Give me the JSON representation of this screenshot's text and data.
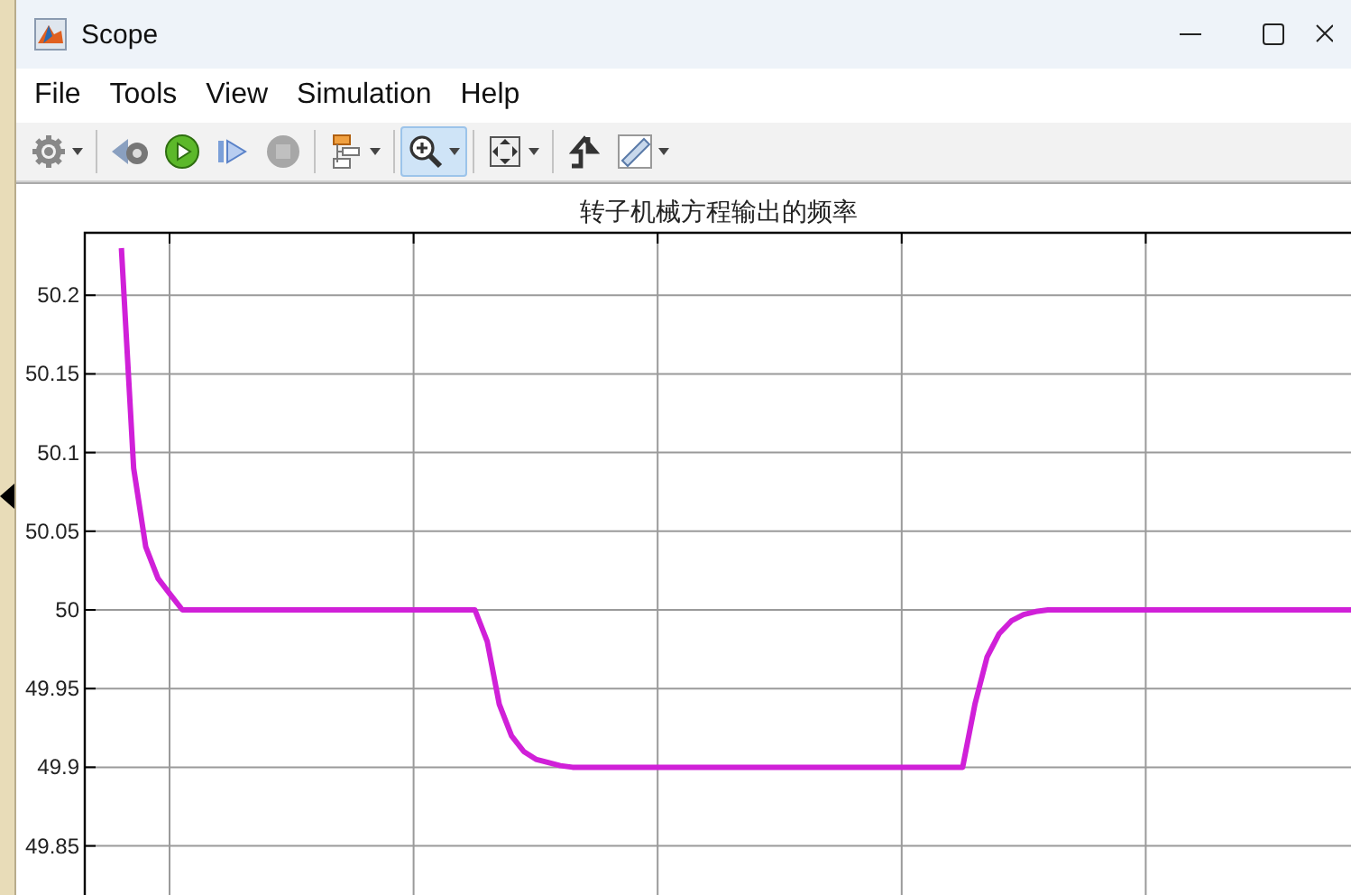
{
  "window": {
    "title": "Scope"
  },
  "menu": [
    "File",
    "Tools",
    "View",
    "Simulation",
    "Help"
  ],
  "toolbar": [
    {
      "kind": "gear",
      "dropdown": true,
      "selected": false,
      "disabled": false
    },
    {
      "kind": "separator"
    },
    {
      "kind": "rewind",
      "dropdown": false,
      "selected": false,
      "disabled": false
    },
    {
      "kind": "play",
      "dropdown": false,
      "selected": false,
      "disabled": false
    },
    {
      "kind": "step",
      "dropdown": false,
      "selected": false,
      "disabled": false
    },
    {
      "kind": "stop",
      "dropdown": false,
      "selected": false,
      "disabled": true
    },
    {
      "kind": "separator"
    },
    {
      "kind": "layout",
      "dropdown": true,
      "selected": false,
      "disabled": false
    },
    {
      "kind": "separator"
    },
    {
      "kind": "zoom",
      "dropdown": true,
      "selected": true,
      "disabled": false
    },
    {
      "kind": "separator"
    },
    {
      "kind": "fit",
      "dropdown": true,
      "selected": false,
      "disabled": false
    },
    {
      "kind": "separator"
    },
    {
      "kind": "trigger",
      "dropdown": false,
      "selected": false,
      "disabled": false
    },
    {
      "kind": "ruler",
      "dropdown": true,
      "selected": false,
      "disabled": false
    }
  ],
  "plot": {
    "chart_data": {
      "type": "line",
      "title": "转子机械方程输出的频率",
      "categories": [
        null,
        null,
        null,
        null,
        null,
        null,
        null,
        null,
        null,
        null,
        null,
        null,
        null,
        null,
        null,
        null,
        null,
        null,
        null,
        null,
        null,
        null,
        null,
        null,
        null,
        null,
        null,
        null,
        null,
        null,
        null,
        null,
        null,
        null,
        null,
        null,
        null,
        null,
        null,
        null,
        null,
        null,
        null,
        null,
        null,
        null,
        null,
        null,
        null,
        null,
        null,
        null,
        null,
        null,
        null,
        null,
        null,
        null,
        null,
        null,
        null,
        null,
        null,
        null,
        null,
        null,
        null,
        null,
        null,
        null,
        null,
        null,
        null,
        null,
        null,
        null,
        null,
        null,
        null,
        null,
        null,
        null,
        null,
        null,
        null,
        null,
        null,
        null,
        null,
        null,
        null,
        null,
        null,
        null,
        null,
        null,
        null,
        null,
        null,
        null,
        null,
        null
      ],
      "series": [
        {
          "color": "#d020d8",
          "values": [
            50.23,
            50.09,
            50.04,
            50.02,
            50.01,
            50,
            50,
            50,
            50,
            50,
            50,
            50,
            50,
            50,
            50,
            50,
            50,
            50,
            50,
            50,
            50,
            50,
            50,
            50,
            50,
            50,
            50,
            50,
            50,
            50,
            49.98,
            49.94,
            49.92,
            49.91,
            49.905,
            49.903,
            49.901,
            49.9,
            49.9,
            49.9,
            49.9,
            49.9,
            49.9,
            49.9,
            49.9,
            49.9,
            49.9,
            49.9,
            49.9,
            49.9,
            49.9,
            49.9,
            49.9,
            49.9,
            49.9,
            49.9,
            49.9,
            49.9,
            49.9,
            49.9,
            49.9,
            49.9,
            49.9,
            49.9,
            49.9,
            49.9,
            49.9,
            49.9,
            49.9,
            49.9,
            49.94,
            49.97,
            49.985,
            49.993,
            49.997,
            49.999,
            50,
            50,
            50,
            50,
            50,
            50,
            50,
            50,
            50,
            50,
            50,
            50,
            50,
            50,
            50,
            50,
            50,
            50,
            50,
            50,
            50,
            50,
            50,
            50,
            50,
            50
          ]
        }
      ],
      "ylim": [
        49.8165,
        50.2397
      ],
      "grid": true,
      "yticks": [
        {
          "value": 49.85,
          "label": "49.85"
        },
        {
          "value": 49.9,
          "label": "49.9"
        },
        {
          "value": 49.95,
          "label": "49.95"
        },
        {
          "value": 50,
          "label": "50"
        },
        {
          "value": 50.05,
          "label": "50.05"
        },
        {
          "value": 50.1,
          "label": "50.1"
        },
        {
          "value": 50.15,
          "label": "50.15"
        },
        {
          "value": 50.2,
          "label": "50.2"
        }
      ]
    }
  }
}
